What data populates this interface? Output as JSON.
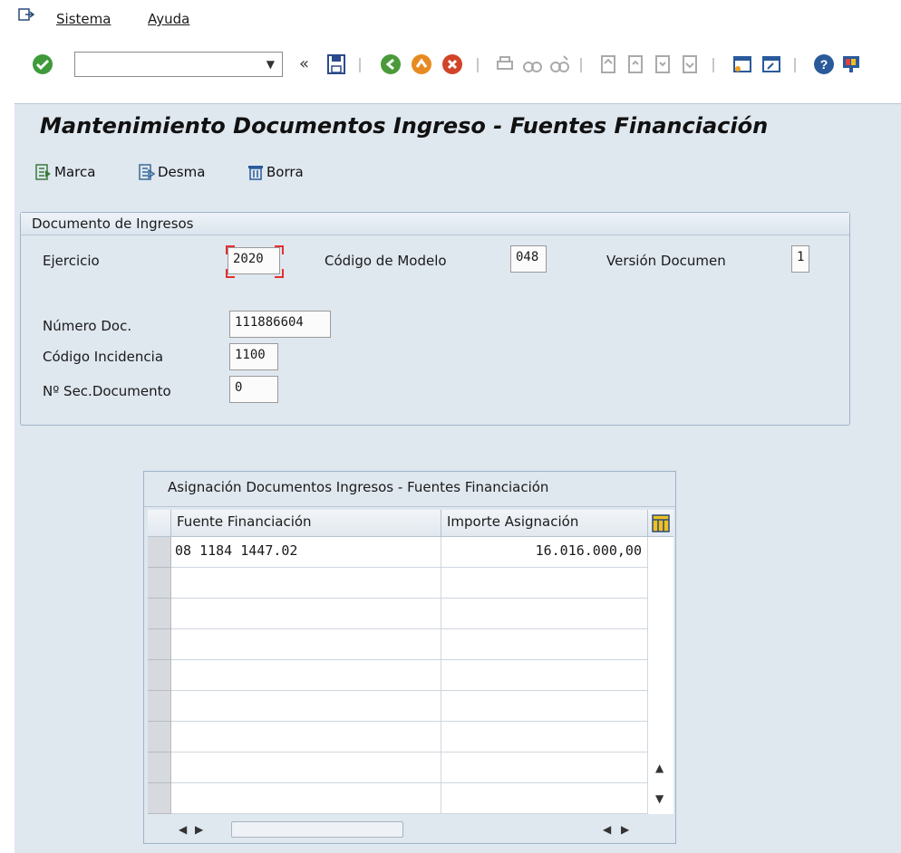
{
  "menu": {
    "sistema": "Sistema",
    "ayuda": "Ayuda"
  },
  "toolbar": {
    "command_value": "",
    "back_glyph": "«"
  },
  "page_title": "Mantenimiento Documentos Ingreso - Fuentes Financiación",
  "app_toolbar": {
    "marca": "Marca",
    "desma": "Desma",
    "borra": "Borra"
  },
  "group": {
    "title": "Documento de Ingresos",
    "ejercicio_label": "Ejercicio",
    "ejercicio_value": "2020",
    "modelo_label": "Código de Modelo",
    "modelo_value": "048",
    "version_label": "Versión Documen",
    "version_value": "1",
    "numero_label": "Número Doc.",
    "numero_value": "111886604",
    "incidencia_label": "Código Incidencia",
    "incidencia_value": "1100",
    "sec_label": "Nº Sec.Documento",
    "sec_value": "0"
  },
  "table": {
    "title": "Asignación Documentos Ingresos - Fuentes Financiación",
    "columns": [
      "Fuente Financiación",
      "Importe Asignación"
    ],
    "rows": [
      [
        "08 1184 1447.02",
        "16.016.000,00"
      ],
      [
        "",
        ""
      ],
      [
        "",
        ""
      ],
      [
        "",
        ""
      ],
      [
        "",
        ""
      ],
      [
        "",
        ""
      ],
      [
        "",
        ""
      ],
      [
        "",
        ""
      ],
      [
        "",
        ""
      ]
    ]
  },
  "colors": {
    "background": "#dfe7ef",
    "focus": "#e33030"
  }
}
